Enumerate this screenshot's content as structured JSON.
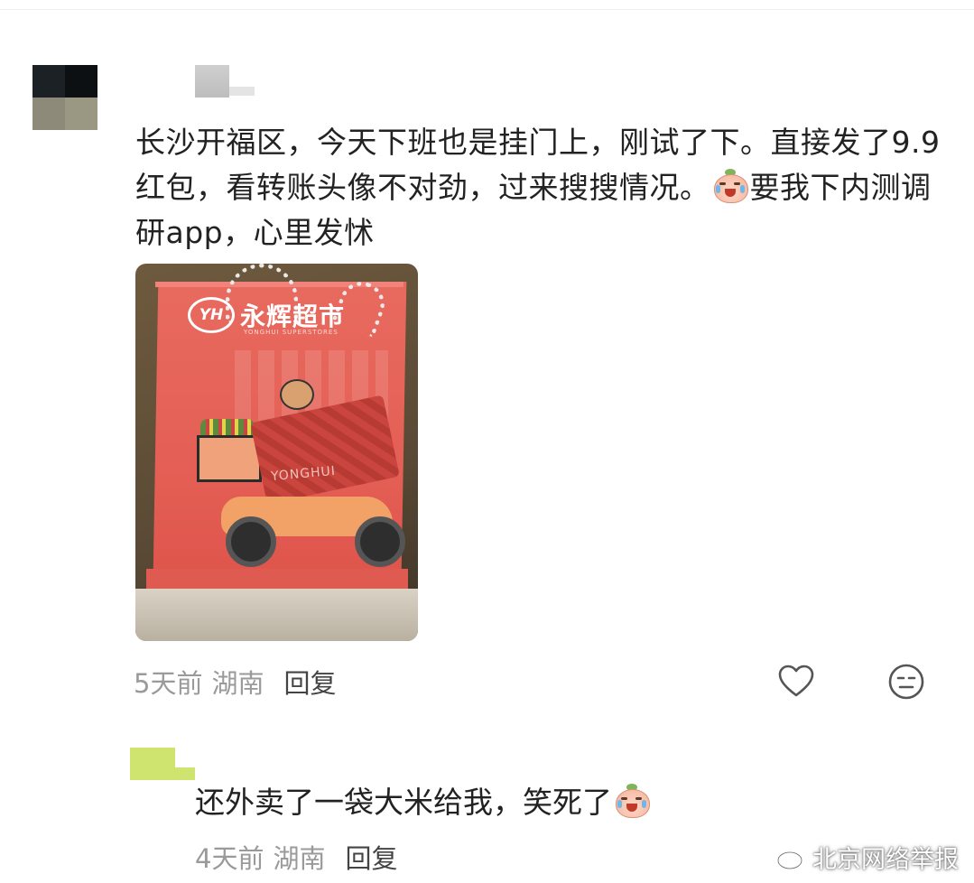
{
  "comment": {
    "text_before_emoji": "长沙开福区，今天下班也是挂门上，刚试了下。直接发了9.9红包，看转账头像不对劲，过来搜搜情况。",
    "text_after_emoji": "要我下内测调研app，心里发怵",
    "emoji_icon": "crying-laughing-peach-emoji",
    "photo": {
      "logo_badge": "YH",
      "brand": "永辉超市",
      "brand_sub": "YONGHUI SUPERSTORES",
      "card_label": "YONGHUI"
    },
    "time": "5天前",
    "location": "湖南",
    "reply_label": "回复"
  },
  "actions": {
    "like_icon": "heart-outline-icon",
    "dislike_icon": "neutral-face-icon"
  },
  "reply": {
    "text": "还外卖了一袋大米给我，笑死了",
    "emoji_icon": "crying-laughing-peach-emoji",
    "time": "4天前",
    "location": "湖南",
    "reply_label": "回复"
  },
  "watermark": {
    "logo": "weibo-icon",
    "text": "北京网络举报"
  },
  "colors": {
    "text_primary": "#222222",
    "text_meta": "#9a9a9a",
    "bag_red": "#e45f55"
  }
}
